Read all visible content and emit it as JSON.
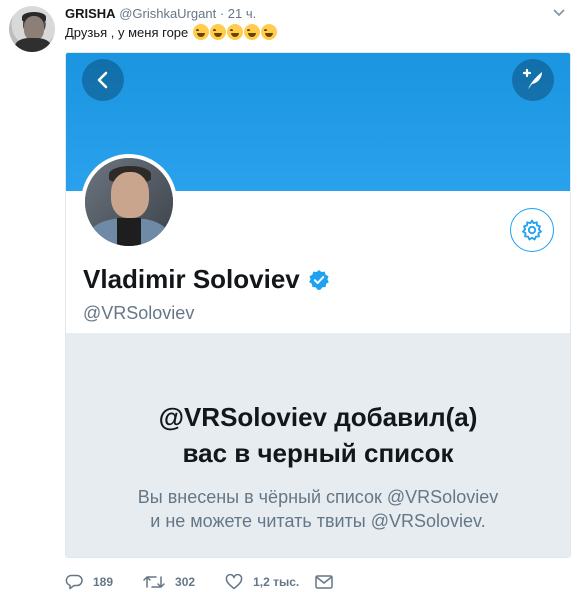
{
  "tweet": {
    "author_name": "GRISHA",
    "author_handle": "@GrishkaUrgant",
    "separator": "·",
    "time": "21 ч.",
    "text": "Друзья , у меня горе",
    "emoji": [
      "😂",
      "😂",
      "😂",
      "😂",
      "😂"
    ]
  },
  "card": {
    "display_name": "Vladimir Soloviev",
    "screen_name": "@VRSoloviev",
    "block_title_line1": "@VRSoloviev добавил(а)",
    "block_title_line2": "вас в черный список",
    "block_desc_line1": "Вы внесены в чёрный список @VRSoloviev",
    "block_desc_line2": "и не можете читать твиты @VRSoloviev.",
    "banner_color": "#1da1f2"
  },
  "actions": {
    "replies": "189",
    "retweets": "302",
    "likes": "1,2 тыс."
  },
  "icons": {
    "caret": "chevron-down-icon",
    "back": "chevron-left-icon",
    "compose": "compose-feather-icon",
    "settings": "gear-icon",
    "verified": "verified-badge-icon",
    "reply": "reply-bubble-icon",
    "retweet": "retweet-icon",
    "like": "heart-icon",
    "dm": "envelope-icon"
  }
}
